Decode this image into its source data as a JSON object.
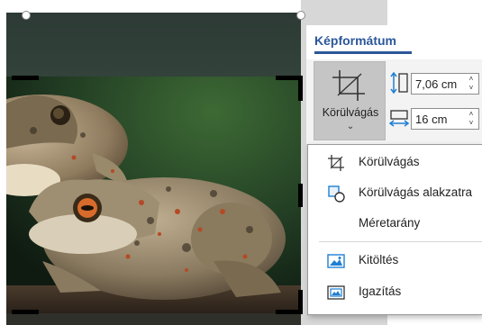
{
  "ribbon": {
    "tab_title": "Képformátum",
    "crop_button_label": "Körülvágás",
    "crop_button_caret": "⌄",
    "height_value": "7,06 cm",
    "width_value": "16 cm",
    "spin_up": "˄",
    "spin_down": "˅"
  },
  "crop_menu": {
    "items": [
      {
        "label": "Körülvágás",
        "icon": "crop-icon"
      },
      {
        "label": "Körülvágás alakzatra",
        "icon": "crop-to-shape-icon"
      },
      {
        "label": "Méretarány",
        "icon": ""
      },
      {
        "label": "Kitöltés",
        "icon": "fill-picture-icon"
      },
      {
        "label": "Igazítás",
        "icon": "fit-picture-icon"
      }
    ]
  },
  "colors": {
    "accent": "#2b579a",
    "ribbon_active": "#c5c5c5",
    "photo_background": "#25402a"
  }
}
